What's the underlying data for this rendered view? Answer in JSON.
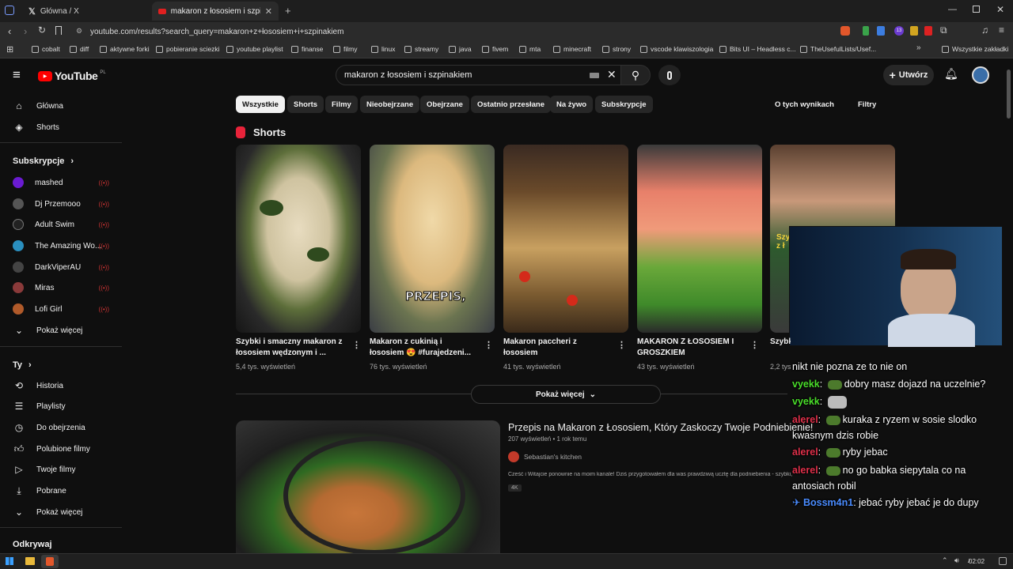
{
  "browser": {
    "tabs": [
      {
        "label": "Główna / X",
        "active": false
      },
      {
        "label": "makaron z łososiem i szpinakiem",
        "active": true
      }
    ],
    "url": "youtube.com/results?search_query=makaron+z+łososiem+i+szpinakiem",
    "bookmarks": [
      "cobalt",
      "diff",
      "aktywne forki",
      "pobieranie sciezki",
      "youtube playlist",
      "finanse",
      "filmy",
      "linux",
      "streamy",
      "java",
      "fivem",
      "mta",
      "minecraft",
      "strony",
      "vscode klawiszologia",
      "Bits UI – Headless c...",
      "TheUsefulLists/Usef...",
      "Wszystkie zakładki"
    ],
    "extension_badge": "13"
  },
  "youtube": {
    "logo": "YouTube",
    "logo_region": "PL",
    "search_value": "makaron z łososiem i szpinakiem",
    "create_label": "Utwórz"
  },
  "sidebar": {
    "main": [
      "Główna",
      "Shorts"
    ],
    "subs_header": "Subskrypcje",
    "subs": [
      {
        "name": "mashed",
        "color": "#6a1bd1"
      },
      {
        "name": "Dj Przemooo",
        "color": "#555555"
      },
      {
        "name": "Adult Swim",
        "color": "#222222"
      },
      {
        "name": "The Amazing Wo...",
        "color": "#2a8fbf"
      },
      {
        "name": "DarkViperAU",
        "color": "#444444"
      },
      {
        "name": "Miras",
        "color": "#8a3a3a"
      },
      {
        "name": "Lofi Girl",
        "color": "#b05a2a"
      }
    ],
    "show_more": "Pokaż więcej",
    "you_header": "Ty",
    "you": [
      "Historia",
      "Playlisty",
      "Do obejrzenia",
      "Polubione filmy",
      "Twoje filmy",
      "Pobrane",
      "Pokaż więcej"
    ],
    "explore_header": "Odkrywaj"
  },
  "chips": [
    "Wszystkie",
    "Shorts",
    "Filmy",
    "Nieobejrzane",
    "Obejrzane",
    "Ostatnio przesłane",
    "Na żywo",
    "Subskrypcje"
  ],
  "about_results": "O tych wynikach",
  "filters": "Filtry",
  "shorts": {
    "header": "Shorts",
    "items": [
      {
        "title": "Szybki i smaczny makaron z łososiem wędzonym i ...",
        "views": "5,4 tys. wyświetleń"
      },
      {
        "title": "Makaron z cukinią i łososiem 😍 #furajedzeni...",
        "views": "76 tys. wyświetleń",
        "overlay": "PRZEPIS,"
      },
      {
        "title": "Makaron paccheri z łososiem",
        "views": "41 tys. wyświetleń"
      },
      {
        "title": "MAKARON Z ŁOSOSIEM I GROSZKIEM",
        "views": "43 tys. wyświetleń"
      },
      {
        "title": "Szybki makaron z łososiem i szpinak",
        "views": "2,2 tys. wy"
      }
    ],
    "show_more": "Pokaż więcej"
  },
  "video": {
    "title": "Przepis na Makaron z Łososiem, Który Zaskoczy Twoje Podniebienie!",
    "meta": "207 wyświetleń • 1 rok temu",
    "channel": "Sebastian's kitchen",
    "desc": "Cześć i Witajcie ponownie na moim kanale! Dziś przygotowałem dla was prawdziwą ucztę dla podniebienia - szybki, zdrowy ...",
    "badge": "4K"
  },
  "chat": [
    {
      "name": "",
      "text": "nikt nie pozna ze to nie on",
      "color": "#ffffff"
    },
    {
      "name": "vyekk",
      "text": "dobry masz dojazd na uczelnie?",
      "color": "#4ade2a"
    },
    {
      "name": "vyekk",
      "text": "",
      "color": "#4ade2a"
    },
    {
      "name": "alerel",
      "text": "kuraka z ryzem w sosie slodko kwasnym dzis robie",
      "color": "#e0304a"
    },
    {
      "name": "alerel",
      "text": "ryby jebac",
      "color": "#e0304a"
    },
    {
      "name": "alerel",
      "text": "no go babka siepytala co na antosiach robil",
      "color": "#e0304a"
    },
    {
      "name": "Bossm4n1",
      "text": "jebać ryby jebać je do dupy",
      "color": "#4a8cff"
    }
  ],
  "taskbar": {
    "time": "02:02"
  }
}
